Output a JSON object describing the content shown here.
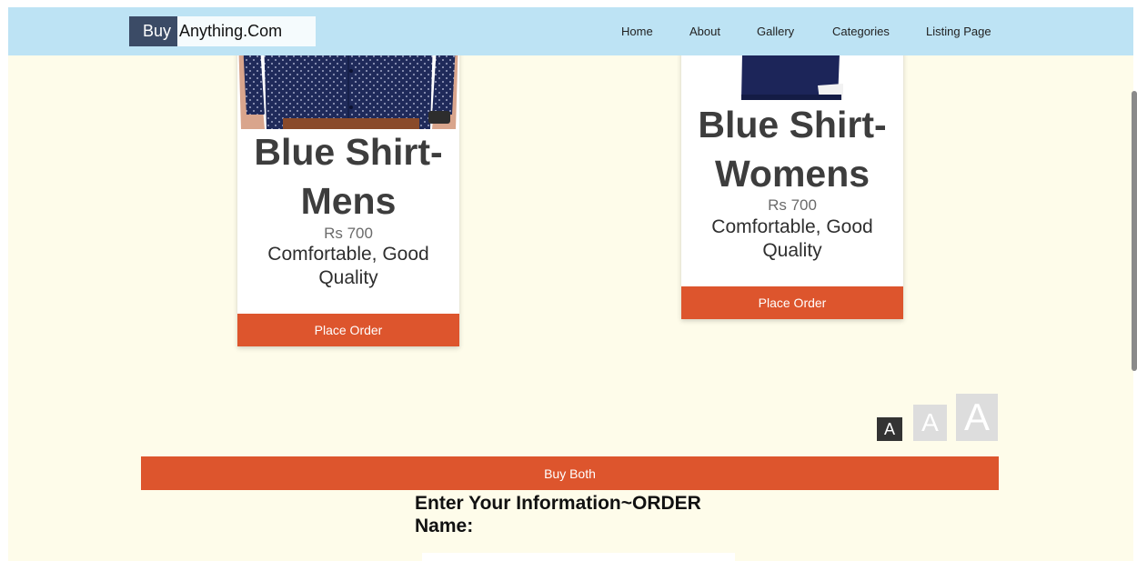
{
  "navbar": {
    "brand_buy": "Buy",
    "brand_rest": "Anything.Com",
    "links": [
      "Home",
      "About",
      "Gallery",
      "Categories",
      "Listing Page"
    ]
  },
  "products": [
    {
      "title_line1": "Blue Shirt-",
      "title_line2": "Mens",
      "price": "Rs 700",
      "desc_line1": "Comfortable, Good",
      "desc_line2": "Quality",
      "button": "Place Order",
      "image_icon": "mens-shirt-photo"
    },
    {
      "title_line1": "Blue Shirt-",
      "title_line2": "Womens",
      "price": "Rs 700",
      "desc_line1": "Comfortable, Good",
      "desc_line2": "Quality",
      "button": "Place Order",
      "image_icon": "womens-shirt-photo"
    }
  ],
  "font_size_controls": {
    "small": "A",
    "medium": "A",
    "large": "A"
  },
  "buy_both_label": "Buy Both",
  "order_form": {
    "heading": "Enter Your Information~ORDER",
    "name_label": "Name:",
    "name_value": ""
  },
  "colors": {
    "navbar_bg": "#bde3f4",
    "page_bg": "#fefcea",
    "accent": "#dd552d",
    "brand_dark": "#3b4b66"
  }
}
